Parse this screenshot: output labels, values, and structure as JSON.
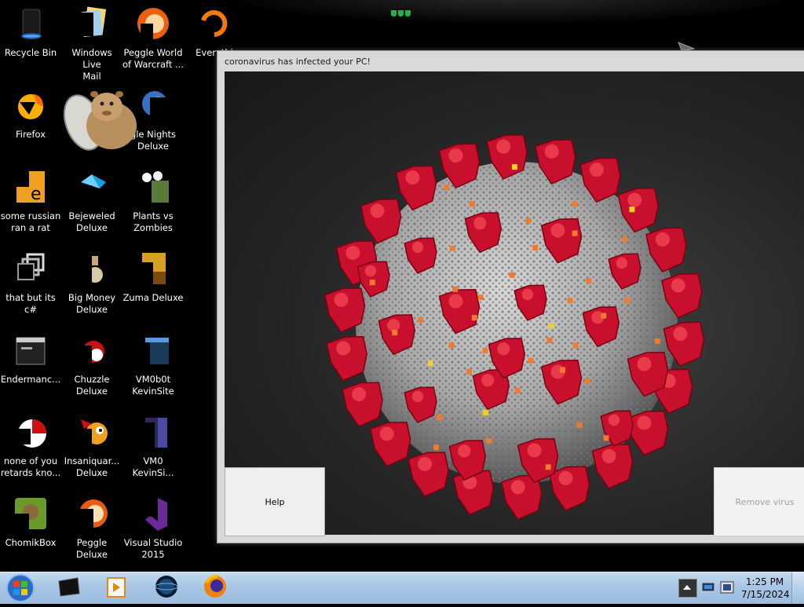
{
  "desktop": {
    "icons": [
      {
        "label": "Recycle Bin",
        "icon": "recycle-bin-icon"
      },
      {
        "label": "Windows Live\nMail",
        "icon": "windows-live-mail-icon"
      },
      {
        "label": "Peggle World\nof Warcraft ...",
        "icon": "peggle-icon"
      },
      {
        "label": "Everythi",
        "icon": "everything-icon"
      },
      {
        "label": "Firefox",
        "icon": "firefox-icon"
      },
      {
        "label": "Deluxe",
        "icon": "game-icon"
      },
      {
        "label": "gle Nights\nDeluxe",
        "icon": "peggle-nights-icon"
      },
      {
        "label": "some russian\nran a rat",
        "icon": "exe-icon"
      },
      {
        "label": "Bejeweled\nDeluxe",
        "icon": "bejeweled-icon"
      },
      {
        "label": "Plants vs\nZombies",
        "icon": "plants-vs-zombies-icon"
      },
      {
        "label": "that but its c#",
        "icon": "shortcut-icon"
      },
      {
        "label": "Big Money\nDeluxe",
        "icon": "big-money-icon"
      },
      {
        "label": "Zuma Deluxe",
        "icon": "zuma-icon"
      },
      {
        "label": "Endermanc...",
        "icon": "endermanch-icon"
      },
      {
        "label": "Chuzzle\nDeluxe",
        "icon": "chuzzle-icon"
      },
      {
        "label": "VM0b0t\nKevinSite",
        "icon": "vm-icon"
      },
      {
        "label": "none of you\nretards kno...",
        "icon": "exe-icon"
      },
      {
        "label": "Insaniquar...\nDeluxe",
        "icon": "insaniquarium-icon"
      },
      {
        "label": "VM0\nKevinSi...",
        "icon": "vm-file-icon"
      },
      {
        "label": "ChomikBox",
        "icon": "chomikbox-icon"
      },
      {
        "label": "Peggle Deluxe",
        "icon": "peggle-icon"
      },
      {
        "label": "Visual Studio\n2015",
        "icon": "visual-studio-icon"
      }
    ]
  },
  "window": {
    "title": "coronavirus has infected your PC!",
    "help_label": "Help",
    "remove_label": "Remove virus"
  },
  "taskbar": {
    "apps": [
      "terminal-icon",
      "media-player-icon",
      "browser-globe-icon",
      "firefox-icon"
    ],
    "clock_time": "1:25 PM",
    "clock_date": "7/15/2024"
  },
  "colors": {
    "virus_red": "#c8102e",
    "virus_body": "#a9a9a9",
    "taskbar": "#a8c6e6"
  }
}
